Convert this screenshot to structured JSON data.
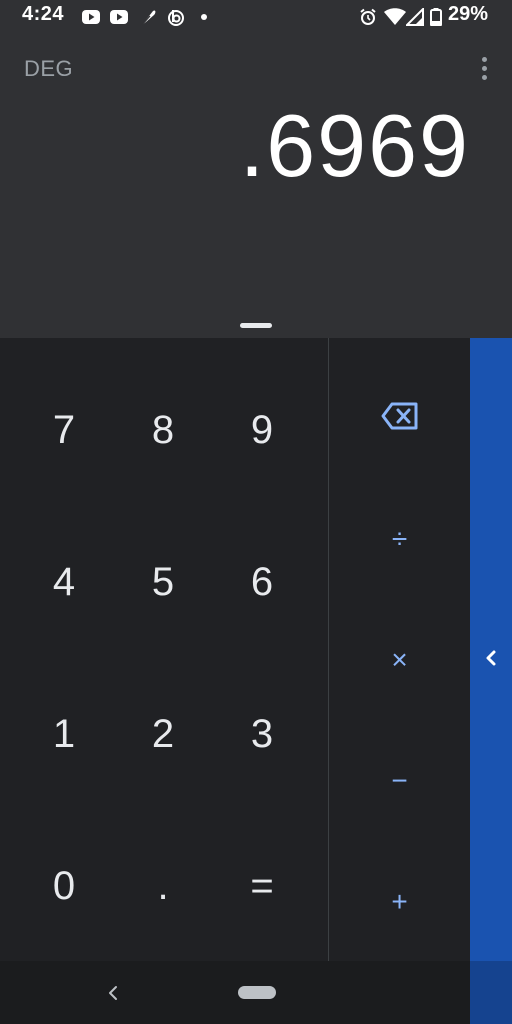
{
  "status_bar": {
    "time": "4:24",
    "battery_text": "29%",
    "icons": [
      "youtube-icon",
      "youtube-icon",
      "feather-icon",
      "b-circle-icon",
      "dot-icon",
      "alarm-icon",
      "wifi-icon",
      "signal-icon",
      "battery-icon"
    ]
  },
  "display": {
    "mode": "DEG",
    "result": ".6969"
  },
  "keypad": {
    "rows": [
      [
        "7",
        "8",
        "9"
      ],
      [
        "4",
        "5",
        "6"
      ],
      [
        "1",
        "2",
        "3"
      ],
      [
        "0",
        ".",
        "="
      ]
    ]
  },
  "operators": {
    "divide": "÷",
    "multiply": "×",
    "subtract": "−",
    "add": "+"
  },
  "colors": {
    "accent": "#8ab4f8",
    "advanced_panel": "#1a53b0",
    "display_bg": "#303134",
    "keypad_bg": "#202124"
  }
}
